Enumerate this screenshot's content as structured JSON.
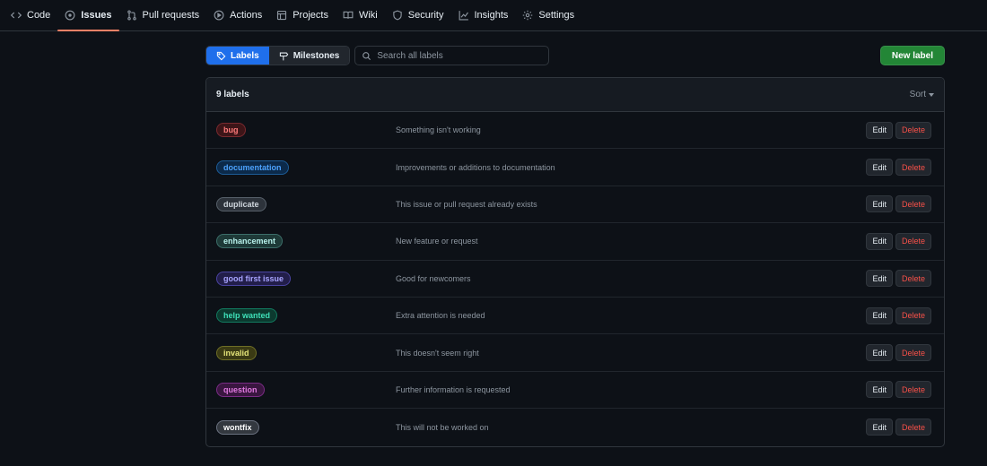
{
  "nav": {
    "items": [
      {
        "label": "Code",
        "icon": "code-icon"
      },
      {
        "label": "Issues",
        "icon": "issue-icon",
        "active": true
      },
      {
        "label": "Pull requests",
        "icon": "pull-request-icon"
      },
      {
        "label": "Actions",
        "icon": "play-icon"
      },
      {
        "label": "Projects",
        "icon": "table-icon"
      },
      {
        "label": "Wiki",
        "icon": "book-icon"
      },
      {
        "label": "Security",
        "icon": "shield-icon"
      },
      {
        "label": "Insights",
        "icon": "graph-icon"
      },
      {
        "label": "Settings",
        "icon": "gear-icon"
      }
    ]
  },
  "toolbar": {
    "labels_tab": "Labels",
    "milestones_tab": "Milestones",
    "search_placeholder": "Search all labels",
    "search_value": "",
    "new_label": "New label"
  },
  "list": {
    "count": "9 labels",
    "sort": "Sort",
    "edit_label": "Edit",
    "delete_label": "Delete",
    "labels": [
      {
        "name": "bug",
        "description": "Something isn't working",
        "text_color": "#ff7b7b",
        "bg_color": "#3d1518",
        "border_color": "#7a2a2f"
      },
      {
        "name": "documentation",
        "description": "Improvements or additions to documentation",
        "text_color": "#4da3ff",
        "bg_color": "#0c2a4a",
        "border_color": "#1d5c96"
      },
      {
        "name": "duplicate",
        "description": "This issue or pull request already exists",
        "text_color": "#d0d7de",
        "bg_color": "#2d333b",
        "border_color": "#57606a"
      },
      {
        "name": "enhancement",
        "description": "New feature or request",
        "text_color": "#b8f2ec",
        "bg_color": "#1e3a38",
        "border_color": "#3c6e69"
      },
      {
        "name": "good first issue",
        "description": "Good for newcomers",
        "text_color": "#a8a4ff",
        "bg_color": "#221e4a",
        "border_color": "#4a43a0"
      },
      {
        "name": "help wanted",
        "description": "Extra attention is needed",
        "text_color": "#3ee0b8",
        "bg_color": "#0c3a2f",
        "border_color": "#127a5f"
      },
      {
        "name": "invalid",
        "description": "This doesn't seem right",
        "text_color": "#e6e67a",
        "bg_color": "#3a3a14",
        "border_color": "#6e6e26"
      },
      {
        "name": "question",
        "description": "Further information is requested",
        "text_color": "#e07ae0",
        "bg_color": "#3a1640",
        "border_color": "#7a2c85"
      },
      {
        "name": "wontfix",
        "description": "This will not be worked on",
        "text_color": "#ffffff",
        "bg_color": "#33383f",
        "border_color": "#6b7280"
      }
    ]
  }
}
